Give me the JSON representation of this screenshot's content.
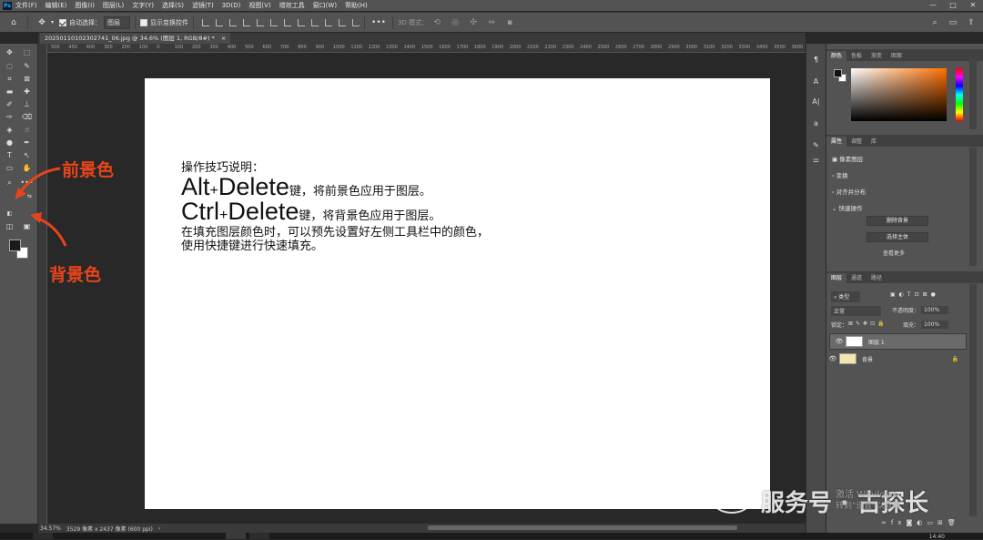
{
  "app": {
    "logo": "Ps"
  },
  "menu": [
    "文件(F)",
    "编辑(E)",
    "图像(I)",
    "图层(L)",
    "文字(Y)",
    "选择(S)",
    "滤镜(T)",
    "3D(D)",
    "视图(V)",
    "增效工具",
    "窗口(W)",
    "帮助(H)"
  ],
  "window_controls": [
    "—",
    "□",
    "✕"
  ],
  "options": {
    "auto_select_label": "自动选择：",
    "auto_select_target": "图层",
    "show_transform_label": "显示变换控件",
    "mode_label": "3D 模式："
  },
  "document": {
    "tab_title": "20250110102302741_06.jpg @ 34.6% (图层 1, RGB/8#) *",
    "tab_close": "×"
  },
  "ruler_ticks": [
    "500",
    "450",
    "400",
    "300",
    "200",
    "100",
    "0",
    "100",
    "200",
    "300",
    "400",
    "500",
    "600",
    "700",
    "800",
    "900",
    "1000",
    "1100",
    "1200",
    "1300",
    "1400",
    "1500",
    "1600",
    "1700",
    "1800",
    "1900",
    "2000",
    "2100",
    "2200",
    "2300",
    "2400",
    "2500",
    "2600",
    "2700",
    "2800",
    "2900",
    "3000",
    "3100",
    "3200",
    "3300",
    "3400",
    "3500",
    "3600"
  ],
  "annotations": {
    "foreground": "前景色",
    "background": "背景色"
  },
  "canvas_text": {
    "line1": "操作技巧说明：",
    "line2_big": "Alt",
    "line2_plus": "+",
    "line2_big2": "Delete",
    "line2_rest": "键，将前景色应用于图层。",
    "line3_big": "Ctrl",
    "line3_plus": "+",
    "line3_big2": "Delete",
    "line3_rest": "键，将背景色应用于图层。",
    "line4": "在填充图层颜色时，可以预先设置好左侧工具栏中的颜色，",
    "line5": "使用快捷键进行快速填充。"
  },
  "status": {
    "zoom": "34.57%",
    "size": "3529 像素 x 2437 像素 (600 ppi)",
    "arrow": "›"
  },
  "color_panel": {
    "tabs": [
      "颜色",
      "色板",
      "渐变",
      "图案"
    ],
    "active": "颜色"
  },
  "properties_panel": {
    "tabs": [
      "属性",
      "调整",
      "库"
    ],
    "active": "属性",
    "pixel_layer": "像素图层",
    "sections": [
      "变换",
      "对齐并分布",
      "快速操作"
    ],
    "buttons": [
      "删除背景",
      "选择主体"
    ],
    "more": "查看更多"
  },
  "layers_panel": {
    "tabs": [
      "图层",
      "通道",
      "路径"
    ],
    "active": "图层",
    "filter": "类型",
    "blend_mode": "正常",
    "opacity_label": "不透明度：",
    "opacity": "100%",
    "lock_label": "锁定：",
    "fill_label": "填充：",
    "fill": "100%",
    "layers": [
      {
        "name": "图层 1",
        "selected": true
      },
      {
        "name": "背景",
        "selected": false,
        "locked": true
      }
    ],
    "footer_icons": [
      "link-icon",
      "fx-icon",
      "mask-icon",
      "adjust-icon",
      "folder-icon",
      "new-layer-icon",
      "trash-icon"
    ]
  },
  "watermark": {
    "text": "服务号 · 古探长",
    "sub1": "激活 Windows",
    "sub2": "转到\"设置\"以激活"
  },
  "clock": "14:40",
  "colors": {
    "accent_red": "#e8441c",
    "panel": "#535353",
    "canvas_bg": "#282828"
  }
}
